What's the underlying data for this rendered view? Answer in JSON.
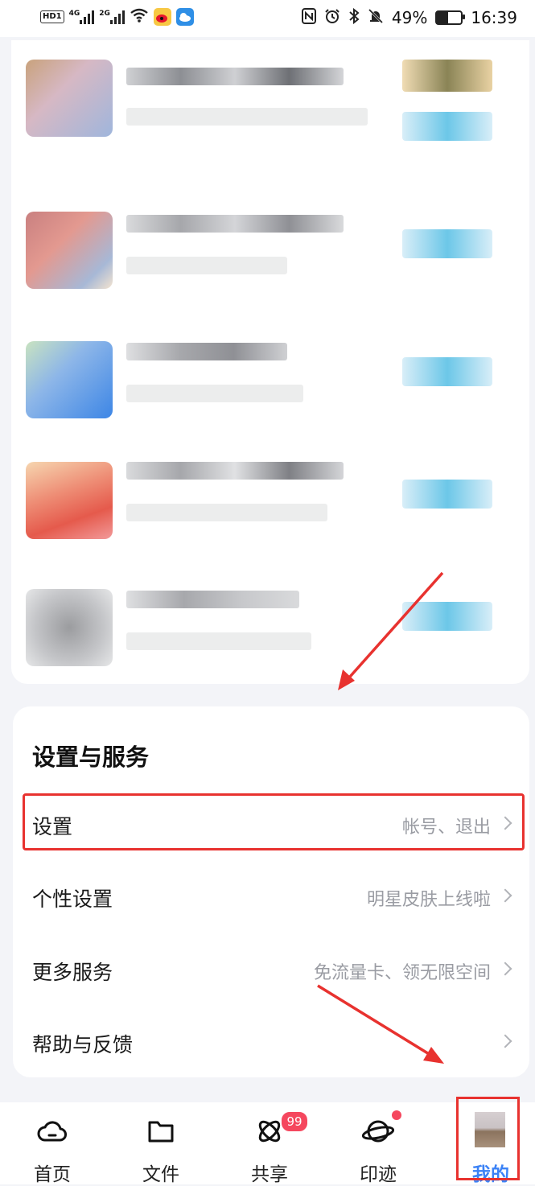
{
  "status_bar": {
    "hd": "HD",
    "sim": "1",
    "net1": "4G",
    "net2": "2G",
    "battery_percent": "49%",
    "time": "16:39"
  },
  "colors": {
    "accent": "#3b82f6",
    "badge": "#f5475e",
    "annotation": "#e8322f"
  },
  "settings_section": {
    "title": "设置与服务",
    "items": [
      {
        "label": "设置",
        "sub": "帐号、退出"
      },
      {
        "label": "个性设置",
        "sub": "明星皮肤上线啦"
      },
      {
        "label": "更多服务",
        "sub": "免流量卡、领无限空间"
      },
      {
        "label": "帮助与反馈",
        "sub": ""
      }
    ]
  },
  "tabs": [
    {
      "label": "首页",
      "icon": "cloud-icon"
    },
    {
      "label": "文件",
      "icon": "folder-icon"
    },
    {
      "label": "共享",
      "icon": "share-orbit-icon",
      "badge": "99"
    },
    {
      "label": "印迹",
      "icon": "planet-icon",
      "dot": true
    },
    {
      "label": "我的",
      "icon": "avatar",
      "active": true
    }
  ]
}
